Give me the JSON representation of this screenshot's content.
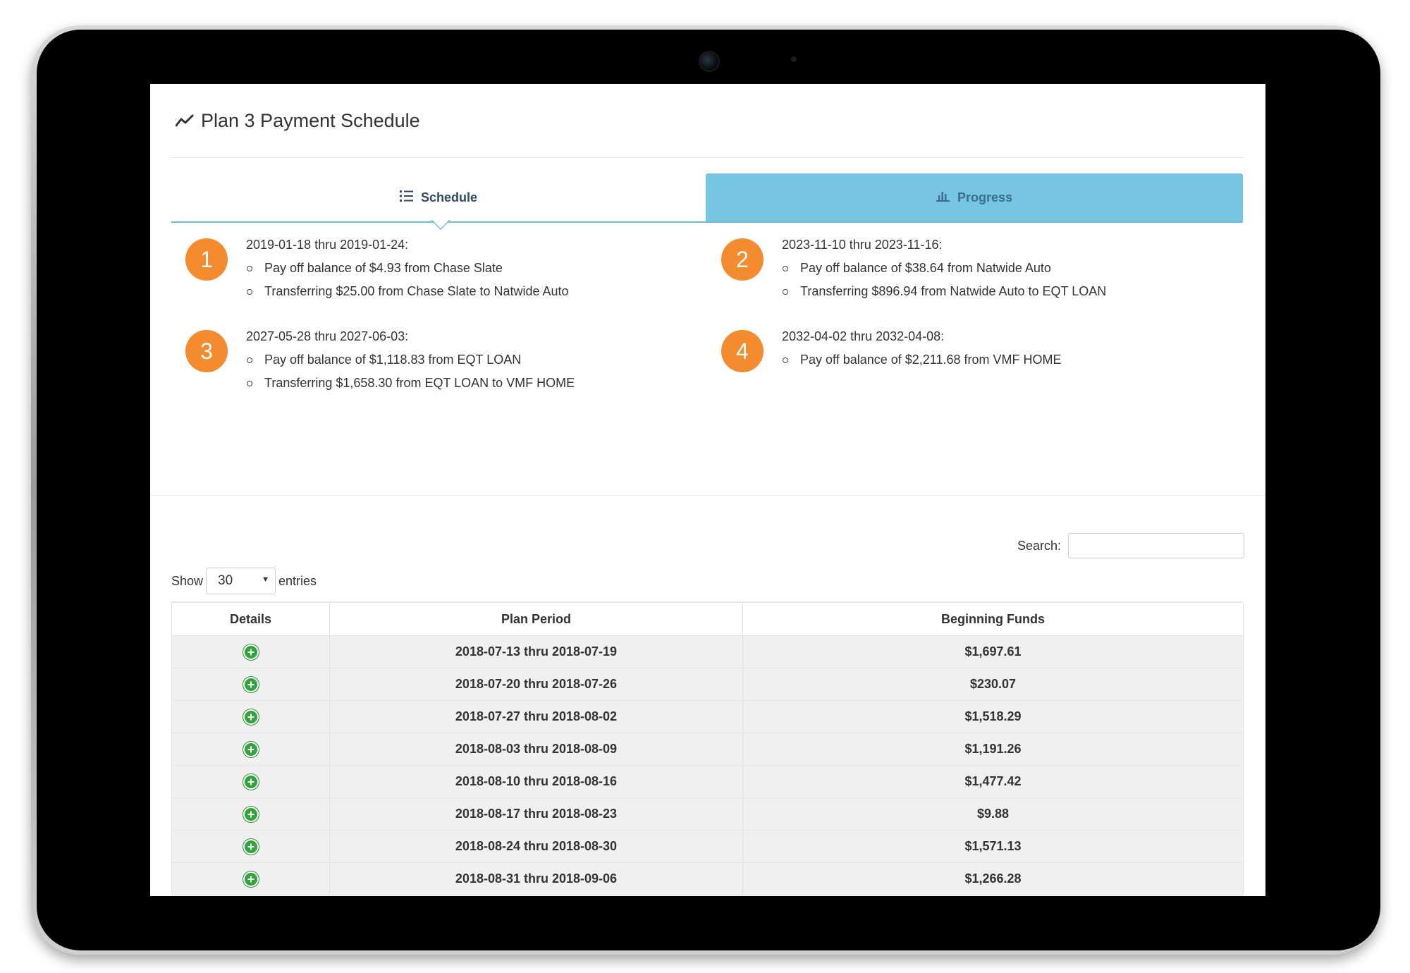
{
  "header": {
    "title": "Plan 3 Payment Schedule",
    "icon": "line-chart-icon"
  },
  "tabs": [
    {
      "label": "Schedule",
      "icon": "list-icon",
      "active": true
    },
    {
      "label": "Progress",
      "icon": "bar-chart-icon",
      "active": false
    }
  ],
  "colors": {
    "badge": "#f58b2f",
    "tab_active_bg": "#76c5e2",
    "expand_icon": "#31a43c"
  },
  "milestones": [
    {
      "number": "1",
      "date": "2019-01-18 thru 2019-01-24:",
      "items": [
        "Pay off balance of $4.93 from Chase Slate",
        "Transferring $25.00 from Chase Slate to Natwide Auto"
      ]
    },
    {
      "number": "2",
      "date": "2023-11-10 thru 2023-11-16:",
      "items": [
        "Pay off balance of $38.64 from Natwide Auto",
        "Transferring $896.94 from Natwide Auto to EQT LOAN"
      ]
    },
    {
      "number": "3",
      "date": "2027-05-28 thru 2027-06-03:",
      "items": [
        "Pay off balance of $1,118.83 from EQT LOAN",
        "Transferring $1,658.30 from EQT LOAN to VMF HOME"
      ]
    },
    {
      "number": "4",
      "date": "2032-04-02 thru 2032-04-08:",
      "items": [
        "Pay off balance of $2,211.68 from VMF HOME"
      ]
    }
  ],
  "controls": {
    "search_label": "Search:",
    "search_value": "",
    "show_label": "Show",
    "entries_value": "30",
    "entries_label": "entries"
  },
  "table": {
    "columns": [
      "Details",
      "Plan Period",
      "Beginning Funds"
    ],
    "rows": [
      {
        "period": "2018-07-13 thru 2018-07-19",
        "funds": "$1,697.61"
      },
      {
        "period": "2018-07-20 thru 2018-07-26",
        "funds": "$230.07"
      },
      {
        "period": "2018-07-27 thru 2018-08-02",
        "funds": "$1,518.29"
      },
      {
        "period": "2018-08-03 thru 2018-08-09",
        "funds": "$1,191.26"
      },
      {
        "period": "2018-08-10 thru 2018-08-16",
        "funds": "$1,477.42"
      },
      {
        "period": "2018-08-17 thru 2018-08-23",
        "funds": "$9.88"
      },
      {
        "period": "2018-08-24 thru 2018-08-30",
        "funds": "$1,571.13"
      },
      {
        "period": "2018-08-31 thru 2018-09-06",
        "funds": "$1,266.28"
      }
    ]
  }
}
